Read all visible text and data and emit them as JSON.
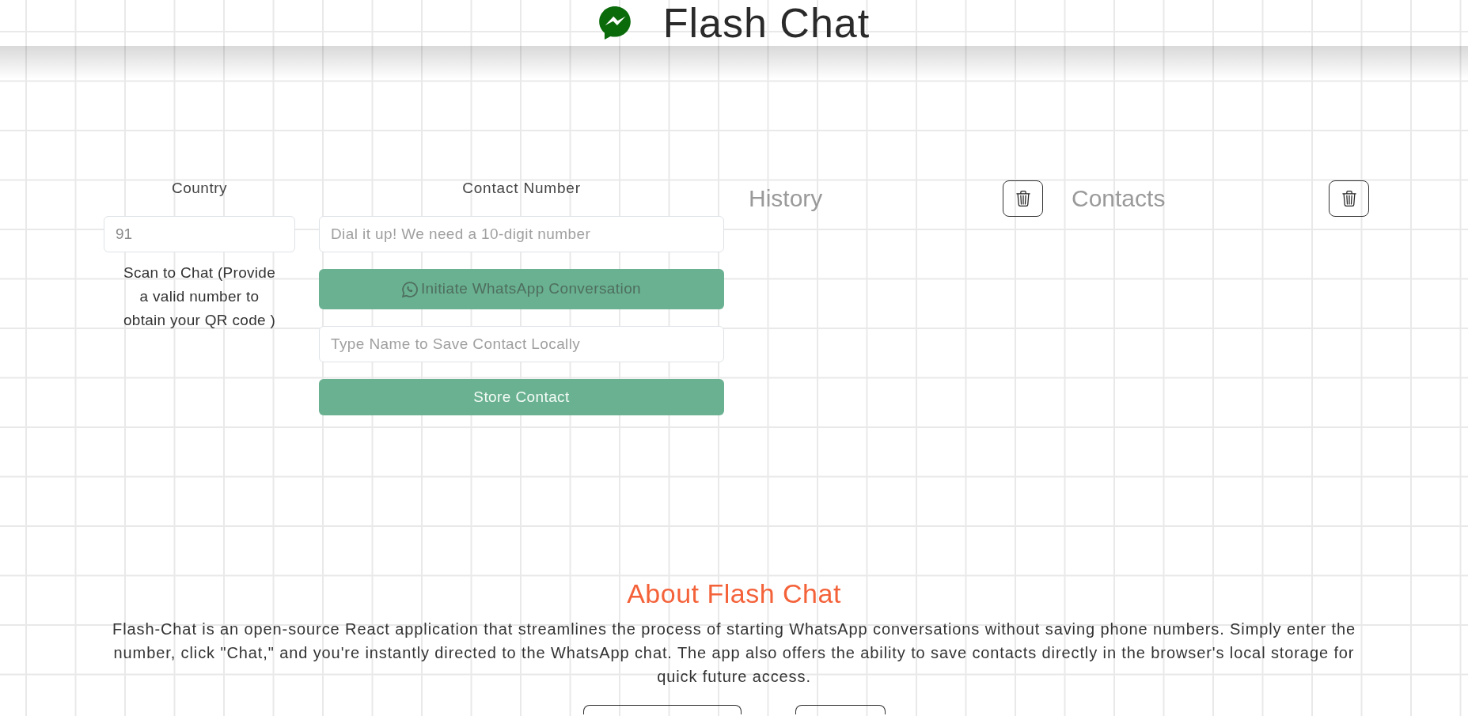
{
  "header": {
    "title": "Flash Chat"
  },
  "form": {
    "country_label": "Country",
    "country_input": {
      "value": "91"
    },
    "qr_caption": "Scan to Chat (Provide a valid number to obtain your QR code )",
    "contact_label": "Contact Number",
    "controls": [
      {
        "kind": "input",
        "placeholder": "Dial it up! We need a 10-digit number"
      },
      {
        "kind": "whatsapp_button",
        "label": "Initiate WhatsApp Conversation"
      },
      {
        "kind": "input",
        "placeholder": "Type Name to Save Contact Locally"
      },
      {
        "kind": "button",
        "label": "Store Contact"
      }
    ]
  },
  "panels": [
    {
      "title": "History"
    },
    {
      "title": "Contacts"
    }
  ],
  "about": {
    "heading": "About Flash Chat",
    "text": "Flash-Chat is an open-source React application that streamlines the process of starting WhatsApp conversations without saving phone numbers. Simply enter the number, click \"Chat,\" and you're instantly directed to the WhatsApp chat. The app also offers the ability to save contacts directly in the browser's local storage for quick future access."
  }
}
